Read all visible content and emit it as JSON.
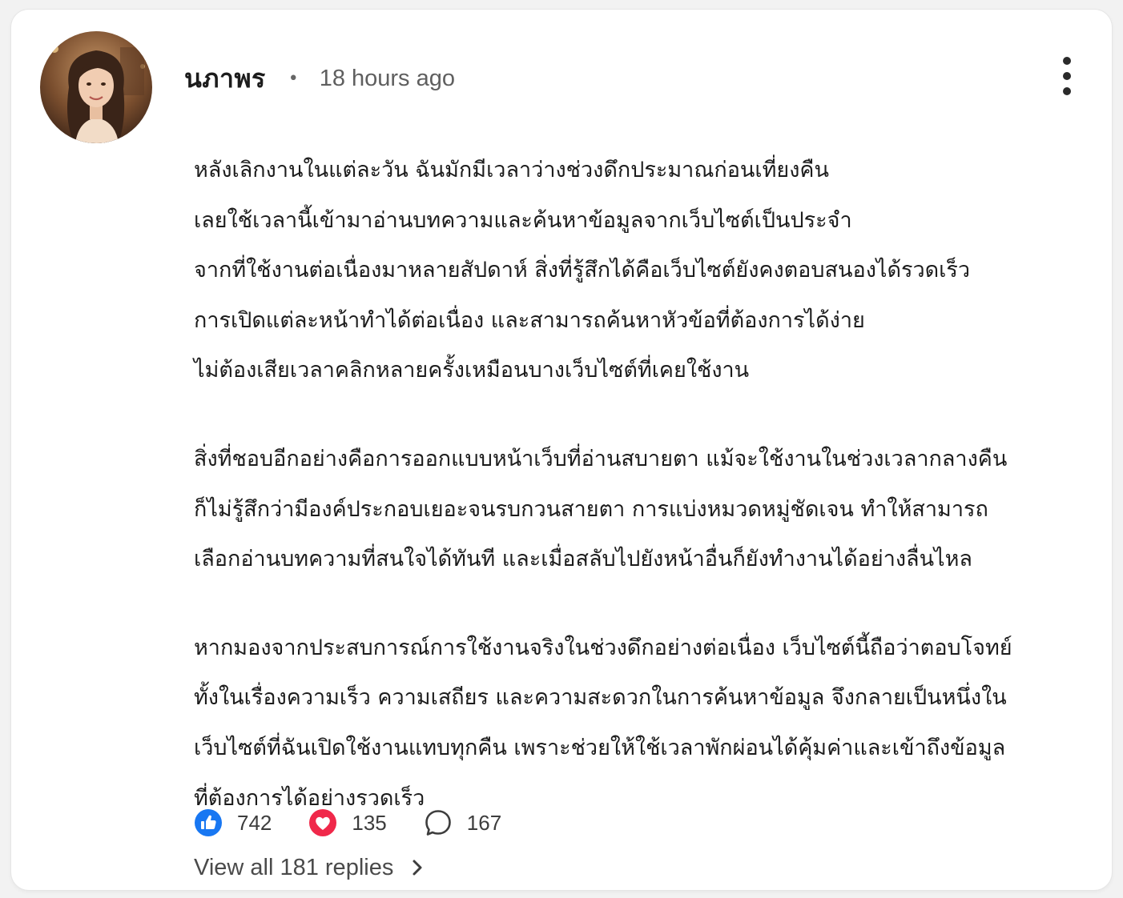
{
  "comment": {
    "author": "นภาพร",
    "separator": "•",
    "timestamp": "18 hours ago",
    "paragraphs": [
      [
        "หลังเลิกงานในแต่ละวัน ฉันมักมีเวลาว่างช่วงดึกประมาณก่อนเที่ยงคืน",
        "เลยใช้เวลานี้เข้ามาอ่านบทความและค้นหาข้อมูลจากเว็บไซต์เป็นประจำ",
        "จากที่ใช้งานต่อเนื่องมาหลายสัปดาห์ สิ่งที่รู้สึกได้คือเว็บไซต์ยังคงตอบสนองได้รวดเร็ว",
        "การเปิดแต่ละหน้าทำได้ต่อเนื่อง และสามารถค้นหาหัวข้อที่ต้องการได้ง่าย",
        "ไม่ต้องเสียเวลาคลิกหลายครั้งเหมือนบางเว็บไซต์ที่เคยใช้งาน"
      ],
      [
        "สิ่งที่ชอบอีกอย่างคือการออกแบบหน้าเว็บที่อ่านสบายตา แม้จะใช้งานในช่วงเวลากลางคืน",
        "ก็ไม่รู้สึกว่ามีองค์ประกอบเยอะจนรบกวนสายตา การแบ่งหมวดหมู่ชัดเจน ทำให้สามารถ",
        "เลือกอ่านบทความที่สนใจได้ทันที และเมื่อสลับไปยังหน้าอื่นก็ยังทำงานได้อย่างลื่นไหล"
      ],
      [
        "หากมองจากประสบการณ์การใช้งานจริงในช่วงดึกอย่างต่อเนื่อง เว็บไซต์นี้ถือว่าตอบโจทย์",
        "ทั้งในเรื่องความเร็ว ความเสถียร และความสะดวกในการค้นหาข้อมูล จึงกลายเป็นหนึ่งใน",
        "เว็บไซต์ที่ฉันเปิดใช้งานแทบทุกคืน เพราะช่วยให้ใช้เวลาพักผ่อนได้คุ้มค่าและเข้าถึงข้อมูล",
        "ที่ต้องการได้อย่างรวดเร็ว"
      ]
    ]
  },
  "reactions": {
    "like": {
      "icon": "like-icon",
      "count": "742",
      "color": "#1877f2"
    },
    "love": {
      "icon": "heart-icon",
      "count": "135",
      "color": "#f0284a"
    },
    "reply": {
      "icon": "comment-icon",
      "count": "167"
    }
  },
  "replies": {
    "label": "View all 181 replies",
    "icon": "chevron-right-icon"
  },
  "menu": {
    "icon": "more-vertical-icon"
  }
}
